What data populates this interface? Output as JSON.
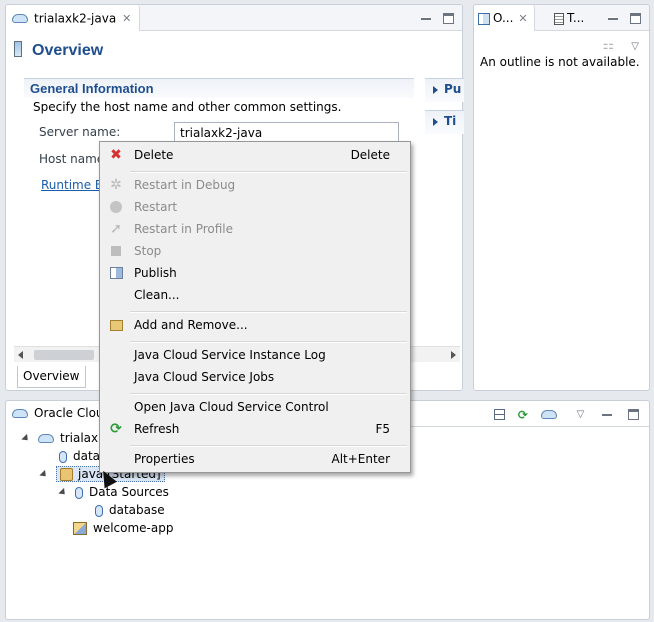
{
  "editor": {
    "tab_label": "trialaxk2-java",
    "overview_title": "Overview",
    "general_info_title": "General Information",
    "general_info_desc": "Specify the host name and other common settings.",
    "server_name_label": "Server name:",
    "server_name_value": "trialaxk2-java",
    "host_name_label": "Host name:",
    "runtime_link": "Runtime Environment:",
    "side_sections": [
      "Pu",
      "Ti"
    ],
    "bottom_tab": "Overview"
  },
  "outline": {
    "tab1_label": "O...",
    "tab2_label": "T...",
    "message": "An outline is not available."
  },
  "cloud": {
    "title": "Oracle Cloud",
    "tree": {
      "server": "trialaxk2-java",
      "server_display": "trialaxk2",
      "data_node": "data",
      "java_node": "java [Started]",
      "data_sources": "Data Sources",
      "database": "database",
      "app": "welcome-app"
    }
  },
  "context_menu": {
    "items": [
      {
        "label": "Delete",
        "shortcut": "Delete",
        "enabled": true,
        "icon": "delete-icon"
      },
      {
        "label": "Restart in Debug",
        "shortcut": "",
        "enabled": false,
        "icon": "debug-icon"
      },
      {
        "label": "Restart",
        "shortcut": "",
        "enabled": false,
        "icon": "restart-icon"
      },
      {
        "label": "Restart in Profile",
        "shortcut": "",
        "enabled": false,
        "icon": "profile-icon"
      },
      {
        "label": "Stop",
        "shortcut": "",
        "enabled": false,
        "icon": "stop-icon"
      },
      {
        "label": "Publish",
        "shortcut": "",
        "enabled": true,
        "icon": "publish-icon"
      },
      {
        "label": "Clean...",
        "shortcut": "",
        "enabled": true,
        "icon": ""
      },
      {
        "label": "Add and Remove...",
        "shortcut": "",
        "enabled": true,
        "icon": "add-remove-icon"
      },
      {
        "label": "Java Cloud Service Instance Log",
        "shortcut": "",
        "enabled": true,
        "icon": ""
      },
      {
        "label": "Java Cloud Service Jobs",
        "shortcut": "",
        "enabled": true,
        "icon": ""
      },
      {
        "label": "Open Java Cloud Service Control",
        "shortcut": "",
        "enabled": true,
        "icon": ""
      },
      {
        "label": "Refresh",
        "shortcut": "F5",
        "enabled": true,
        "icon": "refresh-icon"
      },
      {
        "label": "Properties",
        "shortcut": "Alt+Enter",
        "enabled": true,
        "icon": ""
      }
    ]
  }
}
